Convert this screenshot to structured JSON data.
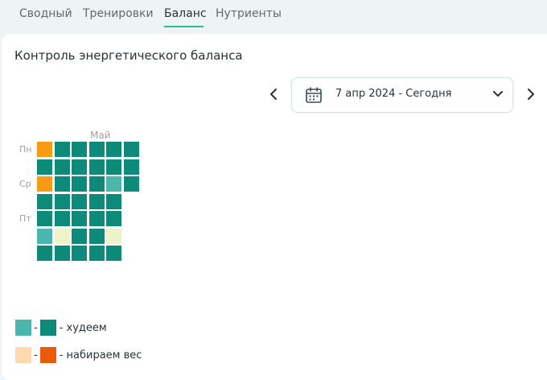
{
  "tabs": [
    {
      "label": "Сводный",
      "active": false
    },
    {
      "label": "Тренировки",
      "active": false
    },
    {
      "label": "Баланс",
      "active": true
    },
    {
      "label": "Нутриенты",
      "active": false
    }
  ],
  "card": {
    "title": "Контроль энергетического баланса"
  },
  "date_range": {
    "label": "7 апр 2024 - Сегодня",
    "icons": [
      "calendar-icon",
      "chevron-down-icon"
    ]
  },
  "nav": {
    "prev_icon": "chevron-left-icon",
    "next_icon": "chevron-right-icon"
  },
  "heatmap": {
    "month_label": "Май",
    "day_labels": [
      "Пн",
      "Ср",
      "Пт"
    ],
    "colors": {
      "dark_green": "#0d8a7a",
      "light_green": "#4db6ac",
      "cream": "#eef3c9",
      "orange": "#f59b15"
    },
    "columns": [
      [
        "orange",
        "dark_green",
        "orange",
        "dark_green",
        "dark_green",
        "light_green",
        "dark_green"
      ],
      [
        "dark_green",
        "dark_green",
        "dark_green",
        "dark_green",
        "dark_green",
        "cream",
        "dark_green"
      ],
      [
        "dark_green",
        "dark_green",
        "dark_green",
        "dark_green",
        "dark_green",
        "dark_green",
        "dark_green"
      ],
      [
        "dark_green",
        "dark_green",
        "dark_green",
        "dark_green",
        "dark_green",
        "dark_green",
        "dark_green"
      ],
      [
        "dark_green",
        "dark_green",
        "light_green",
        "dark_green",
        "dark_green",
        "cream",
        "dark_green"
      ],
      [
        "dark_green",
        "dark_green",
        "dark_green",
        null,
        null,
        null,
        null
      ]
    ]
  },
  "legend": [
    {
      "colors": [
        "#4db6ac",
        "#0d8a7a"
      ],
      "separator": "-",
      "label": "- худеем"
    },
    {
      "colors": [
        "#ffd9b0",
        "#e85a0c"
      ],
      "separator": "-",
      "label": "- набираем вес"
    }
  ]
}
